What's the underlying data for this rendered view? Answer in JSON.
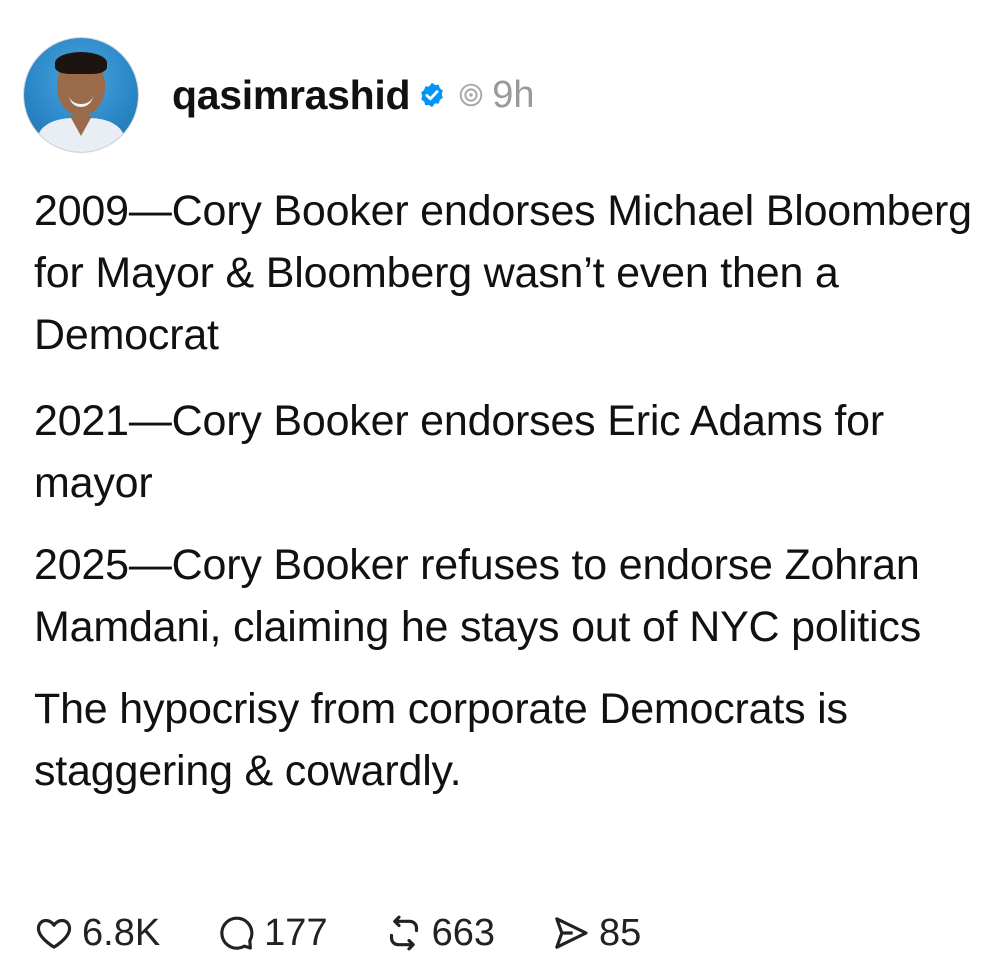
{
  "post": {
    "username": "qasimrashid",
    "time": "9h",
    "icons": {
      "verified": "verified-badge-icon",
      "threads": "threads-icon",
      "like": "heart-icon",
      "reply": "comment-icon",
      "repost": "repost-icon",
      "share": "send-icon"
    },
    "colors": {
      "verified": "#0095f6",
      "muted": "#9a9a9a"
    },
    "paragraphs": [
      "2009—Cory Booker endorses Michael Bloomberg for Mayor & Bloomberg wasn’t even then a Democrat",
      "2021—Cory Booker endorses Eric Adams for mayor",
      "2025—Cory Booker refuses to endorse Zohran Mamdani, claiming he stays out of NYC politics",
      "The hypocrisy from corporate Democrats is staggering & cowardly."
    ],
    "stats": {
      "likes": "6.8K",
      "replies": "177",
      "reposts": "663",
      "shares": "85"
    }
  }
}
